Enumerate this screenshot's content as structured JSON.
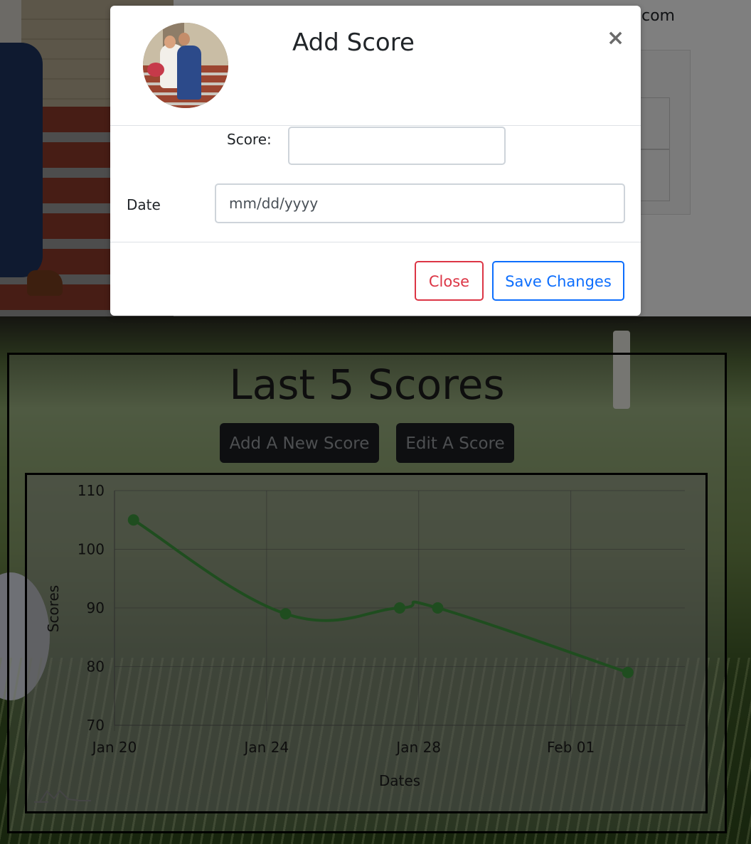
{
  "background": {
    "partial_email_suffix": "com"
  },
  "modal": {
    "title": "Add Score",
    "close_symbol": "×",
    "score_label": "Score:",
    "score_value": "",
    "date_label": "Date",
    "date_placeholder": "mm/dd/yyyy",
    "close_button": "Close",
    "save_button": "Save Changes",
    "avatar_icon": "profile-photo"
  },
  "scores_section": {
    "title": "Last 5 Scores",
    "add_button": "Add A New Score",
    "edit_button": "Edit A Score",
    "watermark_icon": "mountain-logo-icon"
  },
  "colors": {
    "line": "#3f9a3f",
    "danger": "#dc3545",
    "primary": "#0d6efd",
    "dark_button": "#1c1f23"
  },
  "chart_data": {
    "type": "line",
    "xlabel": "Dates",
    "ylabel": "Scores",
    "ylim": [
      70,
      110
    ],
    "yticks": [
      70,
      80,
      90,
      100,
      110
    ],
    "x_tick_labels": [
      "Jan 20",
      "Jan 24",
      "Jan 28",
      "Feb 01"
    ],
    "x_tick_dates": [
      "2025-01-20",
      "2025-01-24",
      "2025-01-28",
      "2025-02-01"
    ],
    "xlim": [
      "2025-01-20",
      "2025-02-04"
    ],
    "grid": true,
    "series": [
      {
        "x": [
          "2025-01-20T12:00",
          "2025-01-24T12:00",
          "2025-01-27T12:00",
          "2025-01-28T12:00",
          "2025-02-02T12:00"
        ],
        "y": [
          105,
          89,
          90,
          90,
          79
        ]
      }
    ]
  }
}
